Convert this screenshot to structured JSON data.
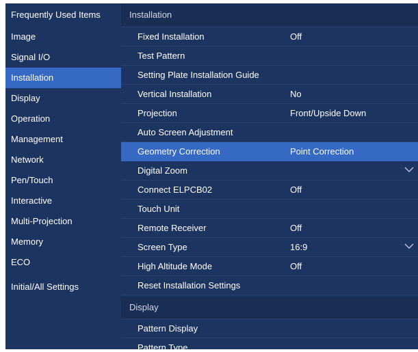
{
  "sidebar": {
    "items": [
      {
        "label": "Frequently Used Items"
      },
      {
        "label": "Image"
      },
      {
        "label": "Signal I/O"
      },
      {
        "label": "Installation"
      },
      {
        "label": "Display"
      },
      {
        "label": "Operation"
      },
      {
        "label": "Management"
      },
      {
        "label": "Network"
      },
      {
        "label": "Pen/Touch"
      },
      {
        "label": "Interactive"
      },
      {
        "label": "Multi-Projection"
      },
      {
        "label": "Memory"
      },
      {
        "label": "ECO"
      },
      {
        "label": "Initial/All Settings"
      }
    ],
    "selected": "Installation"
  },
  "main": {
    "section_installation": "Installation",
    "rows": [
      {
        "label": "Fixed Installation",
        "value": "Off"
      },
      {
        "label": "Test Pattern",
        "value": ""
      },
      {
        "label": "Setting Plate Installation Guide",
        "value": ""
      },
      {
        "label": "Vertical Installation",
        "value": "No"
      },
      {
        "label": "Projection",
        "value": "Front/Upside Down"
      },
      {
        "label": "Auto Screen Adjustment",
        "value": ""
      },
      {
        "label": "Geometry Correction",
        "value": "Point Correction"
      },
      {
        "label": "Digital Zoom",
        "value": ""
      },
      {
        "label": "Connect ELPCB02",
        "value": "Off"
      },
      {
        "label": "Touch Unit",
        "value": ""
      },
      {
        "label": "Remote Receiver",
        "value": "Off"
      },
      {
        "label": "Screen Type",
        "value": "16:9"
      },
      {
        "label": "High Altitude Mode",
        "value": "Off"
      },
      {
        "label": "Reset Installation Settings",
        "value": ""
      }
    ],
    "selected_row": "Geometry Correction",
    "section_display": "Display",
    "display_rows": [
      {
        "label": "Pattern Display"
      },
      {
        "label": "Pattern Type"
      }
    ]
  },
  "icons": {
    "expand": "chevron-down-icon"
  },
  "colors": {
    "background": "#1e3460",
    "selected": "#3569c4",
    "header": "#1a2d55",
    "text": "#ffffff"
  }
}
